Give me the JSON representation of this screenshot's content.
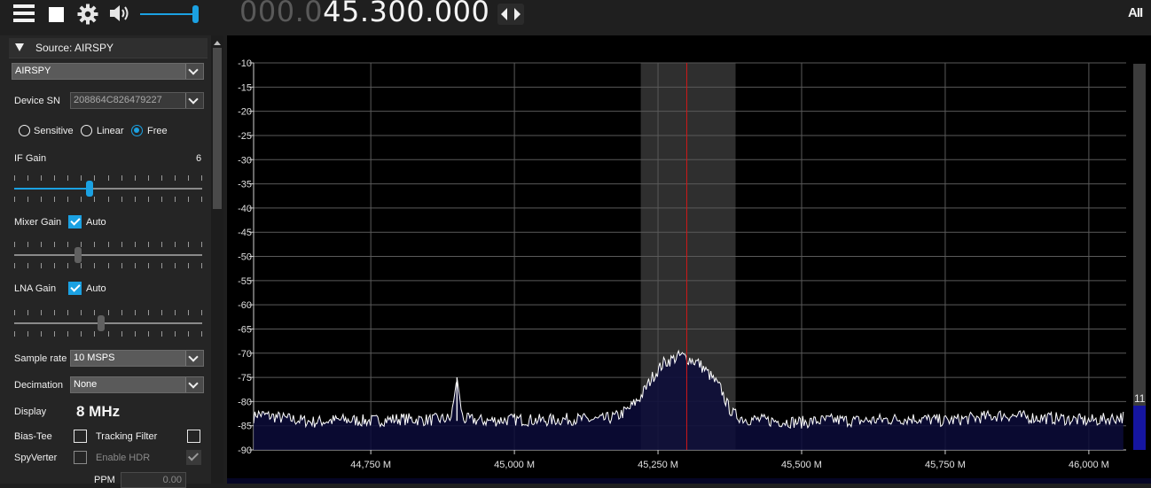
{
  "toolbar": {
    "menu_icon": "hamburger-menu-icon",
    "stop_icon": "stop-icon",
    "settings_icon": "gear-icon",
    "volume_icon": "speaker-icon",
    "frequency_dim": "000.0",
    "frequency_bright": "45.300.000",
    "tune_icon": "left-right-arrows-icon",
    "logo_text": "AII"
  },
  "source_panel": {
    "header": "Source: AIRSPY",
    "source_select": "AIRSPY",
    "device_sn_label": "Device SN",
    "device_sn_value": "208864C826479227",
    "gain_modes": [
      {
        "label": "Sensitive",
        "checked": false
      },
      {
        "label": "Linear",
        "checked": false
      },
      {
        "label": "Free",
        "checked": true
      }
    ],
    "if_gain_label": "IF Gain",
    "if_gain_value": "6",
    "if_gain_level": 0.4,
    "mixer_gain_label": "Mixer Gain",
    "mixer_auto_label": "Auto",
    "mixer_auto": true,
    "mixer_gain_level": 0.34,
    "lna_gain_label": "LNA Gain",
    "lna_auto_label": "Auto",
    "lna_auto": true,
    "lna_gain_level": 0.46,
    "sample_rate_label": "Sample rate",
    "sample_rate_value": "10 MSPS",
    "decimation_label": "Decimation",
    "decimation_value": "None",
    "display_label": "Display",
    "display_value": "8 MHz",
    "bias_tee_label": "Bias-Tee",
    "tracking_filter_label": "Tracking Filter",
    "spyverter_label": "SpyVerter",
    "enable_hdr_label": "Enable HDR",
    "ppm_label": "PPM",
    "ppm_value": "0.00"
  },
  "spectrum": {
    "y_ticks": [
      "-10",
      "-15",
      "-20",
      "-25",
      "-30",
      "-35",
      "-40",
      "-45",
      "-50",
      "-55",
      "-60",
      "-65",
      "-70",
      "-75",
      "-80",
      "-85",
      "-90"
    ],
    "x_ticks": [
      "44,750 M",
      "45,000 M",
      "45,250 M",
      "45,500 M",
      "45,750 M",
      "46,000 M"
    ],
    "right_bar_label": "11",
    "colors": {
      "trace": "#ffffff",
      "fill": "#0c0c3a",
      "passband": "#2f2f2f",
      "tuning_line": "#d01818",
      "grid": "#5a5a5a"
    }
  },
  "chart_data": {
    "type": "line",
    "title": "",
    "xlabel": "",
    "ylabel": "",
    "xlim": [
      44.546,
      46.065
    ],
    "ylim": [
      -90,
      -10
    ],
    "x_unit": "MHz",
    "y_unit": "dB",
    "center_frequency": 45.3,
    "passband": [
      45.22,
      45.385
    ],
    "noise_floor": -84,
    "peaks": [
      {
        "x": 44.9,
        "y": -75
      },
      {
        "x": 45.29,
        "y": -70.5
      }
    ],
    "trace": [
      [
        44.55,
        -82.5
      ],
      [
        44.6,
        -83.5
      ],
      [
        44.65,
        -84.2
      ],
      [
        44.7,
        -83.8
      ],
      [
        44.75,
        -84.0
      ],
      [
        44.8,
        -83.6
      ],
      [
        44.85,
        -83.8
      ],
      [
        44.89,
        -83.5
      ],
      [
        44.9,
        -75.0
      ],
      [
        44.91,
        -83.6
      ],
      [
        44.95,
        -84.0
      ],
      [
        45.0,
        -83.7
      ],
      [
        45.05,
        -83.9
      ],
      [
        45.1,
        -83.6
      ],
      [
        45.15,
        -83.8
      ],
      [
        45.18,
        -83.0
      ],
      [
        45.2,
        -81.5
      ],
      [
        45.22,
        -79.0
      ],
      [
        45.24,
        -75.0
      ],
      [
        45.26,
        -72.0
      ],
      [
        45.28,
        -71.0
      ],
      [
        45.29,
        -70.5
      ],
      [
        45.3,
        -71.0
      ],
      [
        45.32,
        -72.0
      ],
      [
        45.34,
        -74.5
      ],
      [
        45.36,
        -77.5
      ],
      [
        45.37,
        -80.5
      ],
      [
        45.38,
        -82.5
      ],
      [
        45.4,
        -83.6
      ],
      [
        45.45,
        -84.0
      ],
      [
        45.5,
        -84.3
      ],
      [
        45.55,
        -83.8
      ],
      [
        45.6,
        -84.0
      ],
      [
        45.65,
        -83.7
      ],
      [
        45.7,
        -83.5
      ],
      [
        45.75,
        -84.0
      ],
      [
        45.8,
        -83.4
      ],
      [
        45.85,
        -82.8
      ],
      [
        45.9,
        -83.3
      ],
      [
        45.95,
        -83.5
      ],
      [
        46.0,
        -84.0
      ],
      [
        46.06,
        -83.2
      ]
    ]
  }
}
